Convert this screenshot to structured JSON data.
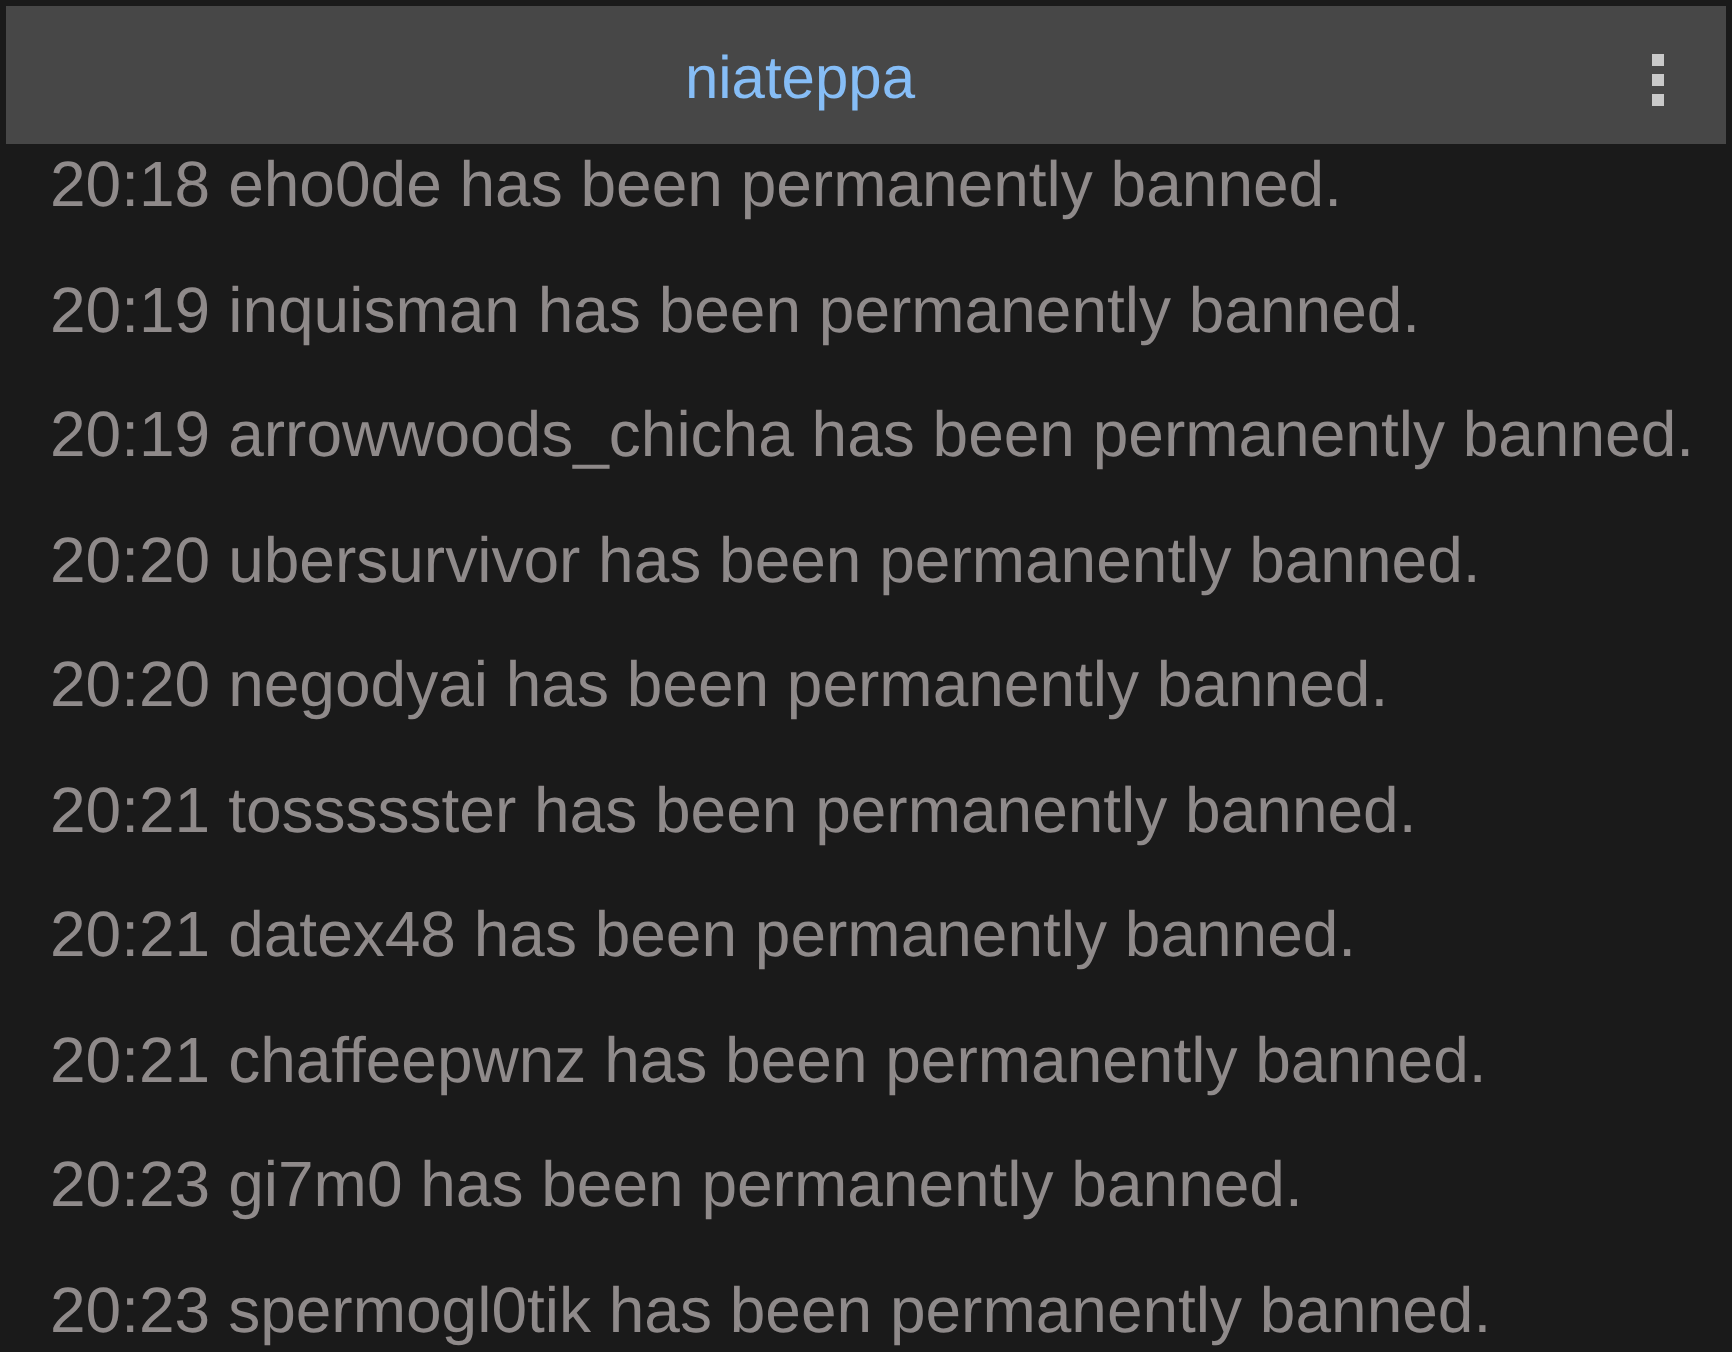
{
  "header": {
    "title": "niateppa"
  },
  "messages": [
    {
      "time": "20:18",
      "text": "eho0de has been permanently banned."
    },
    {
      "time": "20:19",
      "text": "inquisman has been permanently banned."
    },
    {
      "time": "20:19",
      "text": "arrowwoods_chicha has been permanently banned."
    },
    {
      "time": "20:20",
      "text": "ubersurvivor has been permanently banned."
    },
    {
      "time": "20:20",
      "text": "negodyai has been permanently banned."
    },
    {
      "time": "20:21",
      "text": "tossssster has been permanently banned."
    },
    {
      "time": "20:21",
      "text": "datex48 has been permanently banned."
    },
    {
      "time": "20:21",
      "text": "chaffeepwnz has been permanently banned."
    },
    {
      "time": "20:23",
      "text": "gi7m0 has been permanently banned."
    },
    {
      "time": "20:23",
      "text": "spermogl0tik has been permanently banned."
    }
  ]
}
